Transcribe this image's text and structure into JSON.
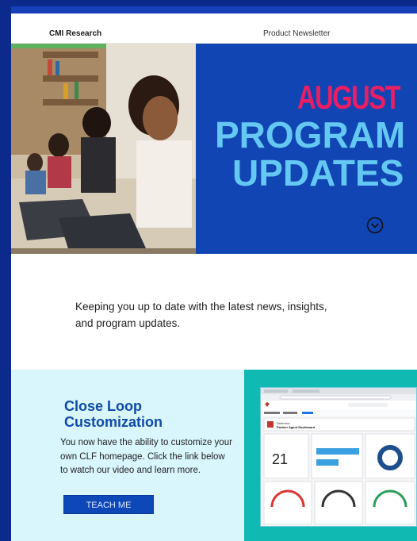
{
  "header": {
    "brand": "CMI Research",
    "newsletter": "Product Newsletter"
  },
  "hero": {
    "line1": "AUGUST",
    "line2": "PROGRAM",
    "line3": "UPDATES"
  },
  "intro": {
    "text": "Keeping you up to date with the latest news, insights, and program updates."
  },
  "feature": {
    "title": "Close Loop Customization",
    "body": "You now have the ability to customize your own CLF homepage.  Click the link below to watch our video and learn more.",
    "button": "TEACH ME",
    "dashboard": {
      "title": "Referrers",
      "subtitle": "Partner Agent Dashboard",
      "kpi_value": "21"
    }
  },
  "colors": {
    "page_border": "#0b2a8c",
    "hero_bg": "#1045b3",
    "august": "#e91e63",
    "headline": "#65c8f3",
    "section_bg": "#d8f6fc",
    "teal": "#10b9b1",
    "button": "#0d47b8"
  }
}
